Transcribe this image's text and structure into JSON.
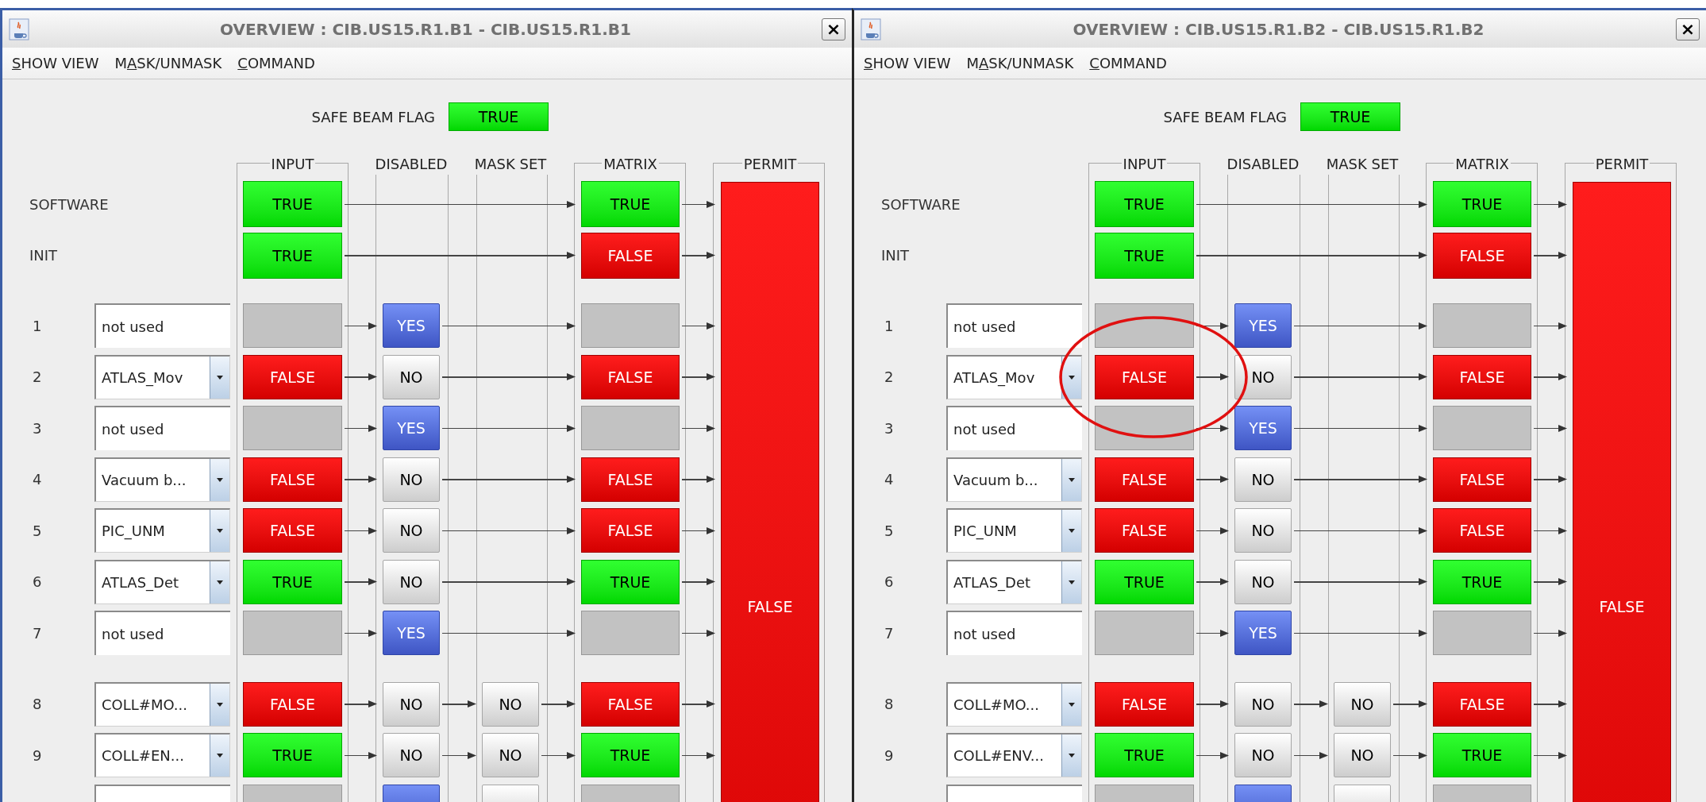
{
  "windows": [
    {
      "title": "OVERVIEW : CIB.US15.R1.B1 - CIB.US15.R1.B1",
      "close": "×",
      "menu": [
        {
          "key": "S",
          "after": "HOW VIEW"
        },
        {
          "before": "M",
          "key": "A",
          "after": "SK/UNMASK"
        },
        {
          "key": "C",
          "after": "OMMAND"
        }
      ],
      "safe_beam": {
        "label": "SAFE BEAM FLAG",
        "value": "TRUE",
        "on": true
      },
      "headers": [
        "INPUT",
        "DISABLED",
        "MASK SET",
        "MATRIX",
        "PERMIT"
      ],
      "system_rows": [
        {
          "label": "SOFTWARE",
          "input": {
            "active": true,
            "on": true,
            "text": "TRUE"
          },
          "matrix": {
            "active": true,
            "on": true,
            "text": "TRUE"
          }
        },
        {
          "label": "INIT",
          "input": {
            "active": true,
            "on": true,
            "text": "TRUE"
          },
          "matrix": {
            "active": true,
            "on": false,
            "text": "FALSE"
          }
        }
      ],
      "channel_groups": [
        {
          "rows": [
            {
              "number": "1",
              "channel": {
                "kind": "text",
                "value": "not used"
              },
              "input": {
                "active": false
              },
              "disabled": {
                "value": "YES",
                "on": true
              },
              "matrix": {
                "active": false
              }
            },
            {
              "number": "2",
              "channel": {
                "kind": "dropdown",
                "value": "ATLAS_Mov"
              },
              "input": {
                "active": true,
                "on": false,
                "text": "FALSE"
              },
              "disabled": {
                "value": "NO",
                "on": false
              },
              "matrix": {
                "active": true,
                "on": false,
                "text": "FALSE"
              }
            },
            {
              "number": "3",
              "channel": {
                "kind": "text",
                "value": "not used"
              },
              "input": {
                "active": false
              },
              "disabled": {
                "value": "YES",
                "on": true
              },
              "matrix": {
                "active": false
              }
            },
            {
              "number": "4",
              "channel": {
                "kind": "dropdown",
                "value": "Vacuum b..."
              },
              "input": {
                "active": true,
                "on": false,
                "text": "FALSE"
              },
              "disabled": {
                "value": "NO",
                "on": false
              },
              "matrix": {
                "active": true,
                "on": false,
                "text": "FALSE"
              }
            },
            {
              "number": "5",
              "channel": {
                "kind": "dropdown",
                "value": "PIC_UNM"
              },
              "input": {
                "active": true,
                "on": false,
                "text": "FALSE"
              },
              "disabled": {
                "value": "NO",
                "on": false
              },
              "matrix": {
                "active": true,
                "on": false,
                "text": "FALSE"
              }
            },
            {
              "number": "6",
              "channel": {
                "kind": "dropdown",
                "value": "ATLAS_Det"
              },
              "input": {
                "active": true,
                "on": true,
                "text": "TRUE"
              },
              "disabled": {
                "value": "NO",
                "on": false
              },
              "matrix": {
                "active": true,
                "on": true,
                "text": "TRUE"
              }
            },
            {
              "number": "7",
              "channel": {
                "kind": "text",
                "value": "not used"
              },
              "input": {
                "active": false
              },
              "disabled": {
                "value": "YES",
                "on": true
              },
              "matrix": {
                "active": false
              }
            }
          ]
        },
        {
          "rows": [
            {
              "number": "8",
              "channel": {
                "kind": "dropdown",
                "value": "COLL#MO..."
              },
              "input": {
                "active": true,
                "on": false,
                "text": "FALSE"
              },
              "disabled": {
                "value": "NO",
                "on": false
              },
              "mask": {
                "value": "NO",
                "on": false
              },
              "matrix": {
                "active": true,
                "on": false,
                "text": "FALSE"
              }
            },
            {
              "number": "9",
              "channel": {
                "kind": "dropdown",
                "value": "COLL#EN..."
              },
              "input": {
                "active": true,
                "on": true,
                "text": "TRUE"
              },
              "disabled": {
                "value": "NO",
                "on": false
              },
              "mask": {
                "value": "NO",
                "on": false
              },
              "matrix": {
                "active": true,
                "on": true,
                "text": "TRUE"
              }
            },
            {
              "cut": true,
              "channel": {
                "kind": "text"
              },
              "input": {
                "active": false
              },
              "disabled": {
                "on": true
              },
              "mask": {
                "on": false
              },
              "matrix": {
                "active": false
              }
            }
          ]
        }
      ],
      "permit": {
        "active": true,
        "on": false,
        "text": "FALSE"
      }
    },
    {
      "title": "OVERVIEW : CIB.US15.R1.B2 - CIB.US15.R1.B2",
      "close": "×",
      "menu": [
        {
          "key": "S",
          "after": "HOW VIEW"
        },
        {
          "before": "M",
          "key": "A",
          "after": "SK/UNMASK"
        },
        {
          "key": "C",
          "after": "OMMAND"
        }
      ],
      "safe_beam": {
        "label": "SAFE BEAM FLAG",
        "value": "TRUE",
        "on": true
      },
      "headers": [
        "INPUT",
        "DISABLED",
        "MASK SET",
        "MATRIX",
        "PERMIT"
      ],
      "system_rows": [
        {
          "label": "SOFTWARE",
          "input": {
            "active": true,
            "on": true,
            "text": "TRUE"
          },
          "matrix": {
            "active": true,
            "on": true,
            "text": "TRUE"
          }
        },
        {
          "label": "INIT",
          "input": {
            "active": true,
            "on": true,
            "text": "TRUE"
          },
          "matrix": {
            "active": true,
            "on": false,
            "text": "FALSE"
          }
        }
      ],
      "channel_groups": [
        {
          "rows": [
            {
              "number": "1",
              "channel": {
                "kind": "text",
                "value": "not used"
              },
              "input": {
                "active": false
              },
              "disabled": {
                "value": "YES",
                "on": true
              },
              "matrix": {
                "active": false
              }
            },
            {
              "number": "2",
              "channel": {
                "kind": "dropdown",
                "value": "ATLAS_Mov"
              },
              "input": {
                "active": true,
                "on": false,
                "text": "FALSE"
              },
              "disabled": {
                "value": "NO",
                "on": false
              },
              "matrix": {
                "active": true,
                "on": false,
                "text": "FALSE"
              },
              "circled": true
            },
            {
              "number": "3",
              "channel": {
                "kind": "text",
                "value": "not used"
              },
              "input": {
                "active": false
              },
              "disabled": {
                "value": "YES",
                "on": true
              },
              "matrix": {
                "active": false
              }
            },
            {
              "number": "4",
              "channel": {
                "kind": "dropdown",
                "value": "Vacuum b..."
              },
              "input": {
                "active": true,
                "on": false,
                "text": "FALSE"
              },
              "disabled": {
                "value": "NO",
                "on": false
              },
              "matrix": {
                "active": true,
                "on": false,
                "text": "FALSE"
              }
            },
            {
              "number": "5",
              "channel": {
                "kind": "dropdown",
                "value": "PIC_UNM"
              },
              "input": {
                "active": true,
                "on": false,
                "text": "FALSE"
              },
              "disabled": {
                "value": "NO",
                "on": false
              },
              "matrix": {
                "active": true,
                "on": false,
                "text": "FALSE"
              }
            },
            {
              "number": "6",
              "channel": {
                "kind": "dropdown",
                "value": "ATLAS_Det"
              },
              "input": {
                "active": true,
                "on": true,
                "text": "TRUE"
              },
              "disabled": {
                "value": "NO",
                "on": false
              },
              "matrix": {
                "active": true,
                "on": true,
                "text": "TRUE"
              }
            },
            {
              "number": "7",
              "channel": {
                "kind": "text",
                "value": "not used"
              },
              "input": {
                "active": false
              },
              "disabled": {
                "value": "YES",
                "on": true
              },
              "matrix": {
                "active": false
              }
            }
          ]
        },
        {
          "rows": [
            {
              "number": "8",
              "channel": {
                "kind": "dropdown",
                "value": "COLL#MO..."
              },
              "input": {
                "active": true,
                "on": false,
                "text": "FALSE"
              },
              "disabled": {
                "value": "NO",
                "on": false
              },
              "mask": {
                "value": "NO",
                "on": false
              },
              "matrix": {
                "active": true,
                "on": false,
                "text": "FALSE"
              }
            },
            {
              "number": "9",
              "channel": {
                "kind": "dropdown",
                "value": "COLL#ENV..."
              },
              "input": {
                "active": true,
                "on": true,
                "text": "TRUE"
              },
              "disabled": {
                "value": "NO",
                "on": false
              },
              "mask": {
                "value": "NO",
                "on": false
              },
              "matrix": {
                "active": true,
                "on": true,
                "text": "TRUE"
              }
            },
            {
              "cut": true,
              "channel": {
                "kind": "text"
              },
              "input": {
                "active": false
              },
              "disabled": {
                "on": true
              },
              "mask": {
                "on": false
              },
              "matrix": {
                "active": false
              }
            }
          ]
        }
      ],
      "permit": {
        "active": true,
        "on": false,
        "text": "FALSE"
      }
    }
  ]
}
